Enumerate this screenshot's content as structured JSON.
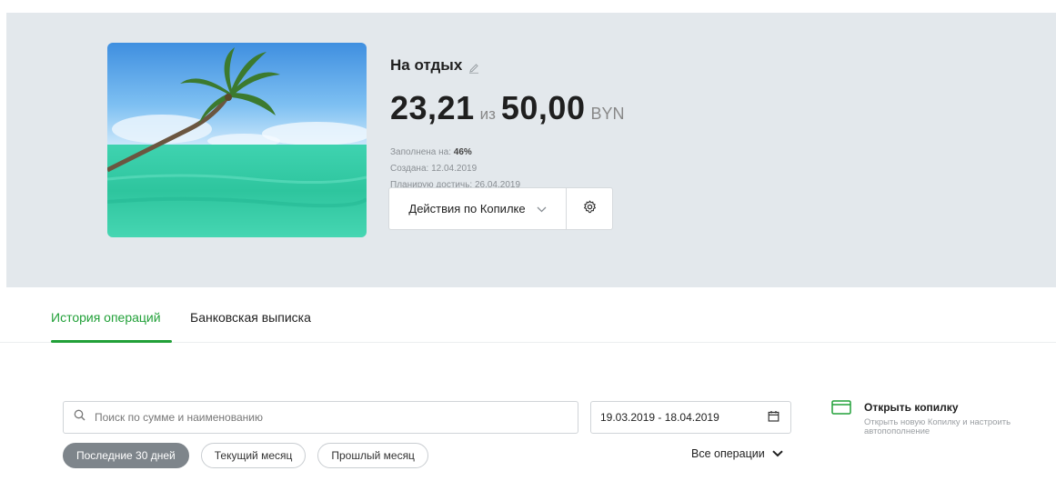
{
  "goal": {
    "title": "На отдых",
    "current_amount": "23,21",
    "of_label": "из",
    "target_amount": "50,00",
    "currency": "BYN",
    "filled_label": "Заполнена на:",
    "filled_value": "46%",
    "created_label": "Создана:",
    "created_date": "12.04.2019",
    "plan_label": "Планирую достичь:",
    "plan_date": "26.04.2019",
    "actions_label": "Действия по Копилке",
    "image_icon": "palm-beach-image"
  },
  "tabs": [
    {
      "label": "История операций",
      "active": true
    },
    {
      "label": "Банковская выписка",
      "active": false
    }
  ],
  "filters": {
    "search_placeholder": "Поиск по сумме и наименованию",
    "date_range": "19.03.2019 - 18.04.2019",
    "chips": [
      {
        "label": "Последние 30 дней",
        "active": true
      },
      {
        "label": "Текущий месяц",
        "active": false
      },
      {
        "label": "Прошлый месяц",
        "active": false
      }
    ],
    "operations_filter": "Все операции"
  },
  "open_piggy": {
    "title": "Открыть копилку",
    "description": "Открыть новую Копилку и настроить автопополнение"
  },
  "colors": {
    "accent": "#21a038",
    "hero_background": "#e3e8ec",
    "chip_active": "#7e858b"
  }
}
